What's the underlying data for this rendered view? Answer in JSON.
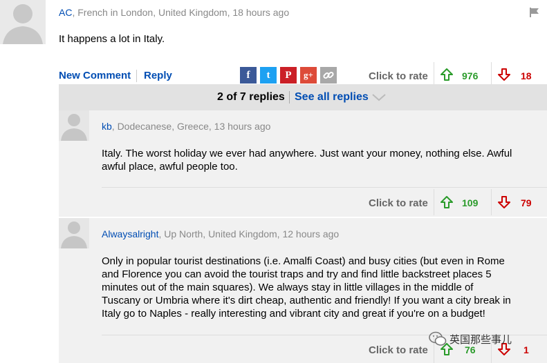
{
  "comment": {
    "author": "AC",
    "location": ", French in London, United Kingdom, 18 hours ago",
    "text": "It happens a lot in Italy.",
    "new_comment_label": "New Comment",
    "reply_label": "Reply",
    "click_to_rate": "Click to rate",
    "up_votes": "976",
    "down_votes": "18"
  },
  "replies_bar": {
    "count_text": "2 of 7 replies",
    "see_all_label": "See all replies"
  },
  "replies": [
    {
      "author": "kb",
      "location": ", Dodecanese, Greece, 13 hours ago",
      "lines": [
        "Italy. The worst holiday we ever had anywhere. Just want your money, nothing else. Awful",
        "awful place, awful people too."
      ],
      "click_to_rate": "Click to rate",
      "up_votes": "109",
      "down_votes": "79"
    },
    {
      "author": "Alwaysalright",
      "location": ", Up North, United Kingdom, 12 hours ago",
      "lines": [
        "Only in popular tourist destinations (i.e. Amalfi Coast) and busy cities (but even in Rome",
        "and Florence you can avoid the tourist traps and try and find little backstreet places 5",
        "minutes out of the main squares). We always stay in little villages in the middle of",
        "Tuscany or Umbria where it's dirt cheap, authentic and friendly! If you want a city break in",
        "Italy go to Naples - really interesting and vibrant city and great if you're on a budget!"
      ],
      "click_to_rate": "Click to rate",
      "up_votes": "76",
      "down_votes": "1"
    }
  ],
  "social": {
    "facebook": "f",
    "twitter": "t",
    "pinterest": "P",
    "googleplus": "g+"
  },
  "watermark": "英国那些事儿",
  "colors": {
    "link": "#004db3",
    "up": "#2a9b2a",
    "down": "#c00000",
    "facebook": "#3b5998",
    "twitter": "#1da1f2",
    "pinterest": "#cb2027",
    "googleplus": "#dd4b39"
  }
}
